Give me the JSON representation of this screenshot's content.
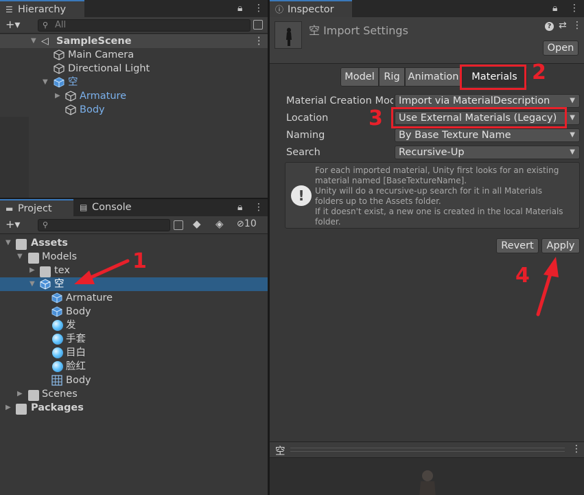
{
  "hierarchy": {
    "tab_label": "Hierarchy",
    "search_placeholder": "All",
    "add_label": "+▾",
    "scene": "SampleScene",
    "items": [
      {
        "label": "Main Camera"
      },
      {
        "label": "Directional Light"
      },
      {
        "label": "空"
      },
      {
        "label": "Armature"
      },
      {
        "label": "Body"
      }
    ]
  },
  "project": {
    "tab_project": "Project",
    "tab_console": "Console",
    "add_label": "+▾",
    "hidden_count": "10",
    "tree": [
      {
        "label": "Assets"
      },
      {
        "label": "Models"
      },
      {
        "label": "tex"
      },
      {
        "label": "空"
      },
      {
        "label": "Armature"
      },
      {
        "label": "Body"
      },
      {
        "label": "发"
      },
      {
        "label": "手套"
      },
      {
        "label": "目白"
      },
      {
        "label": "脸红"
      },
      {
        "label": "Body"
      },
      {
        "label": "Scenes"
      },
      {
        "label": "Packages"
      }
    ]
  },
  "inspector": {
    "tab_label": "Inspector",
    "title": "空 Import Settings",
    "open_label": "Open",
    "tabs": [
      "Model",
      "Rig",
      "Animation",
      "Materials"
    ],
    "active_tab": "Materials",
    "fields": [
      {
        "label": "Material Creation Mode",
        "value": "Import via MaterialDescription"
      },
      {
        "label": "Location",
        "value": "Use External Materials (Legacy)"
      },
      {
        "label": "Naming",
        "value": "By Base Texture Name"
      },
      {
        "label": "Search",
        "value": "Recursive-Up"
      }
    ],
    "help_lines": [
      "For each imported material, Unity first looks for an existing",
      "material named [BaseTextureName].",
      "Unity will do a recursive-up search for it in all Materials",
      "folders up to the Assets folder.",
      "If it doesn't exist, a new one is created in the local Materials",
      "folder."
    ],
    "revert_label": "Revert",
    "apply_label": "Apply",
    "preview_title": "空"
  },
  "annotations": {
    "n1": "1",
    "n2": "2",
    "n3": "3",
    "n4": "4",
    "color": "#e8202a"
  },
  "colors": {
    "selection": "#2c5d87",
    "link_blue": "#7bb1ec",
    "panel": "#383838"
  }
}
